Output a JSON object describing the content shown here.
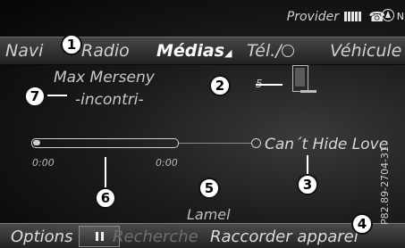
{
  "status_bar": {
    "provider_label": "Provider",
    "signal_bars": 5,
    "north_label": "N"
  },
  "main_menu": {
    "items": [
      {
        "label": "Navi",
        "active": false
      },
      {
        "label": "Radio",
        "active": false
      },
      {
        "label": "Médias",
        "active": true
      },
      {
        "label": "Tél./",
        "active": false
      },
      {
        "label": "Véhicule",
        "active": false
      }
    ]
  },
  "media": {
    "artist": "Max Merseny",
    "album": "-incontri-",
    "track_number": "5",
    "track_title": "Can´t Hide Love",
    "time_elapsed": "0:00",
    "time_total": "0:00",
    "progress_fraction": 0.02,
    "source": "Lamel"
  },
  "bottom_bar": {
    "options_label": "Options",
    "search_label": "Recherche",
    "connect_label": "Raccorder apparei"
  },
  "callouts": [
    "1",
    "2",
    "3",
    "4",
    "5",
    "6",
    "7"
  ],
  "reference_code": "P82.89-2704-31",
  "colors": {
    "background": "#1c1c1c",
    "text": "#d8d8d8",
    "active_text": "#ffffff",
    "callout_fill": "#ffffff"
  },
  "icons": {
    "signal": "signal-strength-icon",
    "phone": "phone-handset-icon",
    "navigation": "compass-north-icon",
    "device": "media-device-icon",
    "pause": "pause-icon",
    "globe": "globe-icon"
  }
}
